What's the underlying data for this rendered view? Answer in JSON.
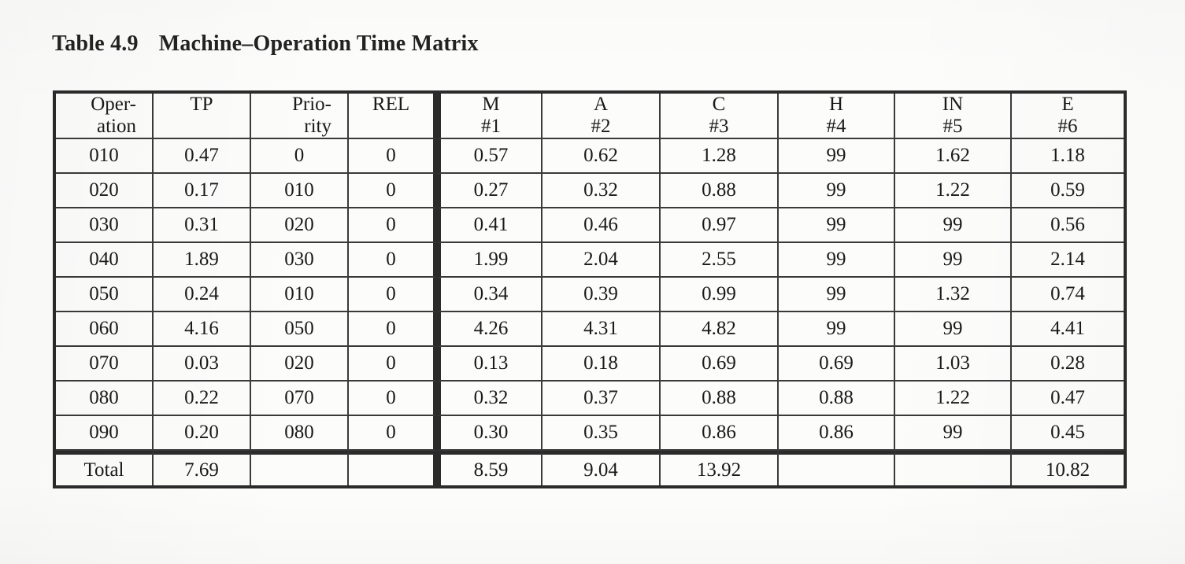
{
  "caption": {
    "number": "Table 4.9",
    "title": "Machine–Operation Time Matrix"
  },
  "table": {
    "headers": [
      {
        "line1": "Oper-",
        "line2": "ation",
        "align": "right"
      },
      {
        "line1": "TP",
        "line2": "",
        "align": "center"
      },
      {
        "line1": "Prio-",
        "line2": "rity",
        "align": "right"
      },
      {
        "line1": "REL",
        "line2": "",
        "align": "center"
      },
      {
        "line1": "M",
        "line2": "#1",
        "align": "center"
      },
      {
        "line1": "A",
        "line2": "#2",
        "align": "center"
      },
      {
        "line1": "C",
        "line2": "#3",
        "align": "center"
      },
      {
        "line1": "H",
        "line2": "#4",
        "align": "center"
      },
      {
        "line1": "IN",
        "line2": "#5",
        "align": "center"
      },
      {
        "line1": "E",
        "line2": "#6",
        "align": "center"
      }
    ],
    "rows": [
      [
        "010",
        "0.47",
        "0",
        "0",
        "0.57",
        "0.62",
        "1.28",
        "99",
        "1.62",
        "1.18"
      ],
      [
        "020",
        "0.17",
        "010",
        "0",
        "0.27",
        "0.32",
        "0.88",
        "99",
        "1.22",
        "0.59"
      ],
      [
        "030",
        "0.31",
        "020",
        "0",
        "0.41",
        "0.46",
        "0.97",
        "99",
        "99",
        "0.56"
      ],
      [
        "040",
        "1.89",
        "030",
        "0",
        "1.99",
        "2.04",
        "2.55",
        "99",
        "99",
        "2.14"
      ],
      [
        "050",
        "0.24",
        "010",
        "0",
        "0.34",
        "0.39",
        "0.99",
        "99",
        "1.32",
        "0.74"
      ],
      [
        "060",
        "4.16",
        "050",
        "0",
        "4.26",
        "4.31",
        "4.82",
        "99",
        "99",
        "4.41"
      ],
      [
        "070",
        "0.03",
        "020",
        "0",
        "0.13",
        "0.18",
        "0.69",
        "0.69",
        "1.03",
        "0.28"
      ],
      [
        "080",
        "0.22",
        "070",
        "0",
        "0.32",
        "0.37",
        "0.88",
        "0.88",
        "1.22",
        "0.47"
      ],
      [
        "090",
        "0.20",
        "080",
        "0",
        "0.30",
        "0.35",
        "0.86",
        "0.86",
        "99",
        "0.45"
      ]
    ],
    "total_row": [
      "Total",
      "7.69",
      "",
      "",
      "8.59",
      "9.04",
      "13.92",
      "",
      "",
      "10.82"
    ]
  },
  "chart_data": {
    "type": "table",
    "title": "Table 4.9  Machine–Operation Time Matrix",
    "columns": [
      "Operation",
      "TP",
      "Priority",
      "REL",
      "M #1",
      "A #2",
      "C #3",
      "H #4",
      "IN #5",
      "E #6"
    ],
    "rows": [
      [
        "010",
        "0.47",
        "0",
        "0",
        "0.57",
        "0.62",
        "1.28",
        "99",
        "1.62",
        "1.18"
      ],
      [
        "020",
        "0.17",
        "010",
        "0",
        "0.27",
        "0.32",
        "0.88",
        "99",
        "1.22",
        "0.59"
      ],
      [
        "030",
        "0.31",
        "020",
        "0",
        "0.41",
        "0.46",
        "0.97",
        "99",
        "99",
        "0.56"
      ],
      [
        "040",
        "1.89",
        "030",
        "0",
        "1.99",
        "2.04",
        "2.55",
        "99",
        "99",
        "2.14"
      ],
      [
        "050",
        "0.24",
        "010",
        "0",
        "0.34",
        "0.39",
        "0.99",
        "99",
        "1.32",
        "0.74"
      ],
      [
        "060",
        "4.16",
        "050",
        "0",
        "4.26",
        "4.31",
        "4.82",
        "99",
        "99",
        "4.41"
      ],
      [
        "070",
        "0.03",
        "020",
        "0",
        "0.13",
        "0.18",
        "0.69",
        "0.69",
        "1.03",
        "0.28"
      ],
      [
        "080",
        "0.22",
        "070",
        "0",
        "0.32",
        "0.37",
        "0.88",
        "0.88",
        "1.22",
        "0.47"
      ],
      [
        "090",
        "0.20",
        "080",
        "0",
        "0.30",
        "0.35",
        "0.86",
        "0.86",
        "99",
        "0.45"
      ],
      [
        "Total",
        "7.69",
        "",
        "",
        "8.59",
        "9.04",
        "13.92",
        "",
        "",
        "10.82"
      ]
    ]
  }
}
